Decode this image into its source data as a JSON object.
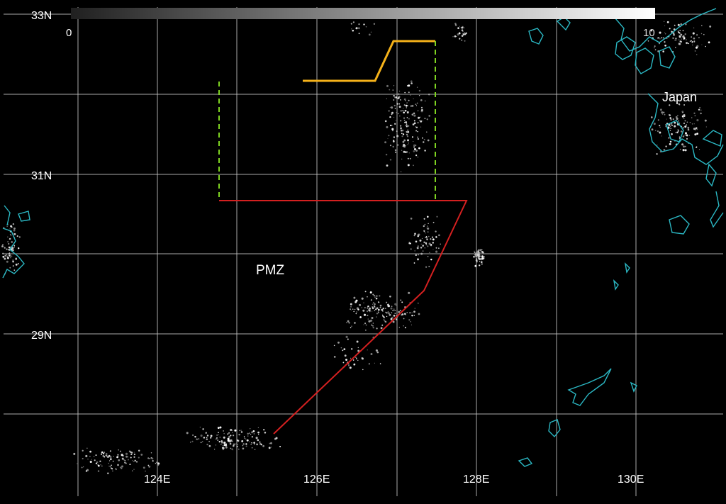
{
  "colorbar": {
    "min_label": "0",
    "max_label": "10",
    "gradient_start": "#202020",
    "gradient_end": "#ffffff"
  },
  "latitude_labels": [
    "33N",
    "31N",
    "29N"
  ],
  "longitude_labels": [
    "124E",
    "126E",
    "128E",
    "130E"
  ],
  "region_labels": {
    "pmz": "PMZ",
    "japan": "Japan"
  },
  "colors": {
    "background": "#000000",
    "grid": "#c8c8c8",
    "coastline": "#2bb8c4",
    "red_boundary": "#d42020",
    "yellow_boundary": "#f5b21a",
    "green_dashed_boundary": "#7ed321",
    "lights": "#ffffff"
  },
  "icons": {
    "coastline": "coastline-outline",
    "lights": "night-light-dots"
  }
}
